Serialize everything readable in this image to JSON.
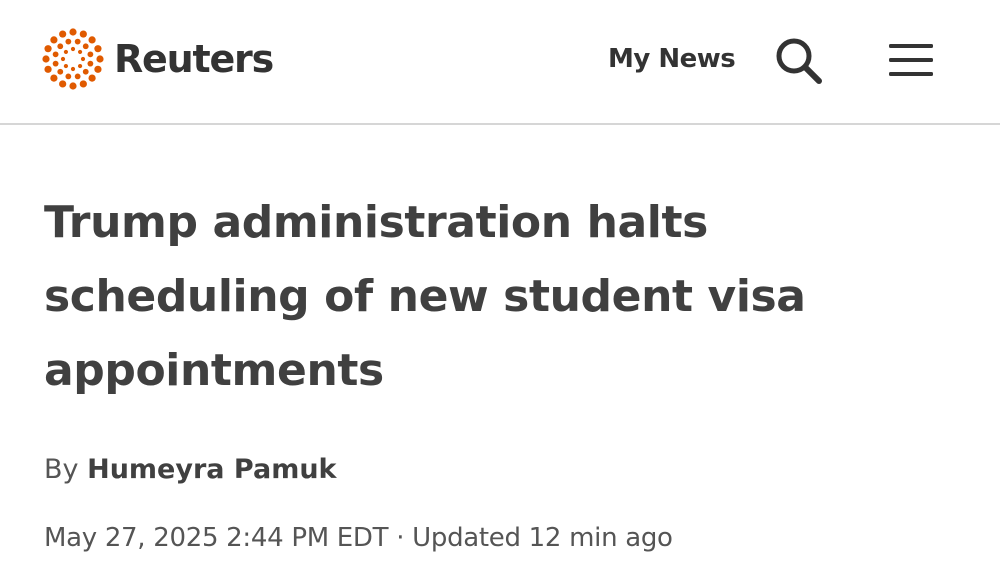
{
  "header": {
    "logo_text": "Reuters",
    "logo_icon": "reuters-dot-ring-logo",
    "my_news_label": "My News",
    "search_icon": "search-icon",
    "menu_icon": "hamburger-menu-icon",
    "brand_color": "#e05a00"
  },
  "article": {
    "headline": "Trump administration halts scheduling of new student visa appointments",
    "byline_prefix": "By",
    "author": "Humeyra Pamuk",
    "published": "May 27, 2025 2:44 PM EDT",
    "separator": "·",
    "updated": "Updated 12 min ago"
  }
}
